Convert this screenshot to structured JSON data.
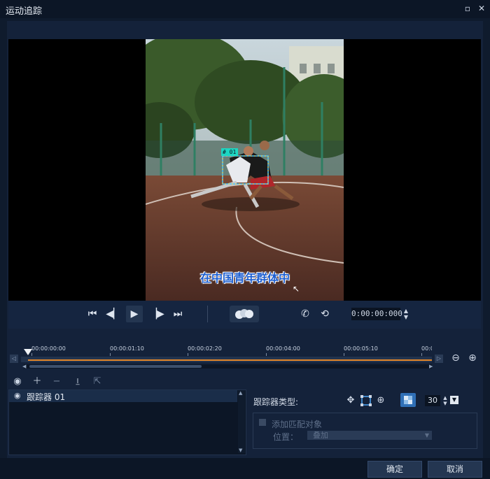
{
  "window": {
    "title": "运动追踪"
  },
  "video": {
    "caption": "在中国青年群体中",
    "tracker_box_label": "# 01"
  },
  "playback": {
    "timecode": "0:00:00:000"
  },
  "timeline": {
    "ticks": [
      "00:00:00:00",
      "00:00:01:10",
      "00:00:02:20",
      "00:00:04:00",
      "00:00:05:10",
      "00:0"
    ]
  },
  "tracker_list": {
    "items": [
      {
        "label": "跟踪器 01"
      }
    ]
  },
  "tracker_settings": {
    "type_label": "跟踪器类型:",
    "size_value": "30",
    "add_match_label": "添加匹配对象",
    "position_label": "位置：",
    "position_value": "叠加"
  },
  "footer": {
    "ok_label": "确定",
    "cancel_label": "取消"
  },
  "colors": {
    "accent": "#e2862a",
    "active_blue": "#2f6fb6",
    "tracker_box": "#4fc3f7"
  }
}
